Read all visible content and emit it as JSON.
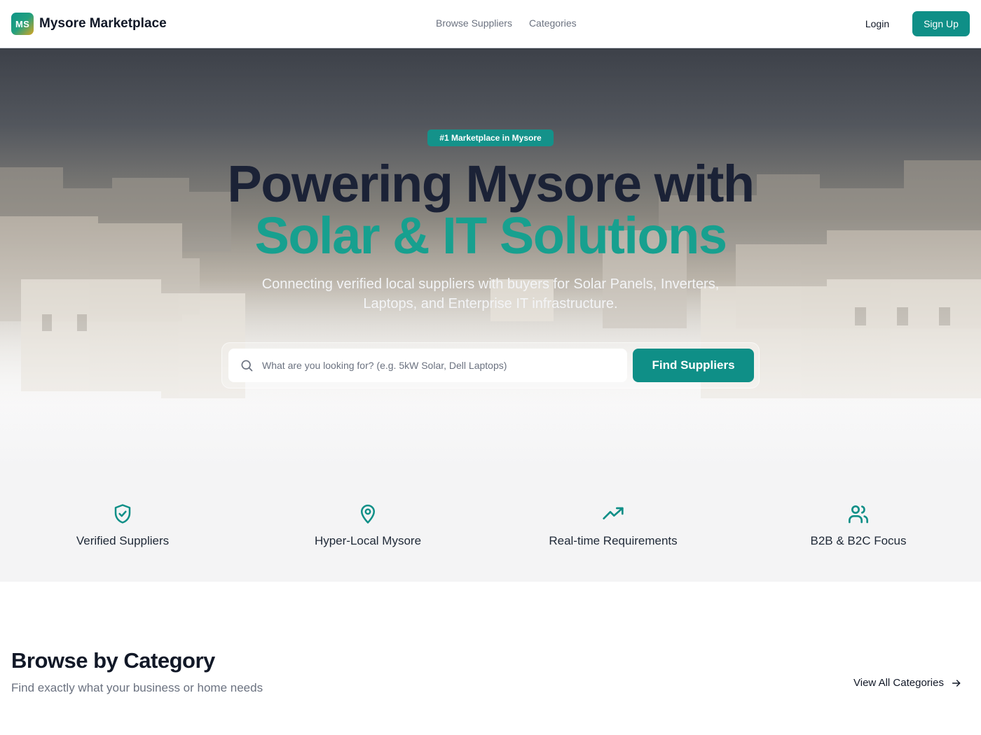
{
  "header": {
    "logo_initials": "MS",
    "brand": "Mysore Marketplace",
    "nav": [
      "Browse Suppliers",
      "Categories"
    ],
    "login": "Login",
    "signup": "Sign Up"
  },
  "hero": {
    "badge": "#1 Marketplace in Mysore",
    "title_line1": "Powering Mysore with",
    "title_line2": "Solar & IT Solutions",
    "subtitle": "Connecting verified local suppliers with buyers for Solar Panels, Inverters, Laptops, and Enterprise IT infrastructure.",
    "search_placeholder": "What are you looking for? (e.g. 5kW Solar, Dell Laptops)",
    "search_button": "Find Suppliers"
  },
  "features": [
    {
      "label": "Verified Suppliers",
      "icon": "shield-check-icon"
    },
    {
      "label": "Hyper-Local Mysore",
      "icon": "map-pin-icon"
    },
    {
      "label": "Real-time Requirements",
      "icon": "trending-up-icon"
    },
    {
      "label": "B2B & B2C Focus",
      "icon": "users-icon"
    }
  ],
  "browse": {
    "title": "Browse by Category",
    "subtitle": "Find exactly what your business or home needs",
    "view_all": "View All Categories"
  },
  "colors": {
    "accent": "#0f8f87",
    "accent_text": "#17a08f",
    "heading_dark": "#1b2236"
  }
}
